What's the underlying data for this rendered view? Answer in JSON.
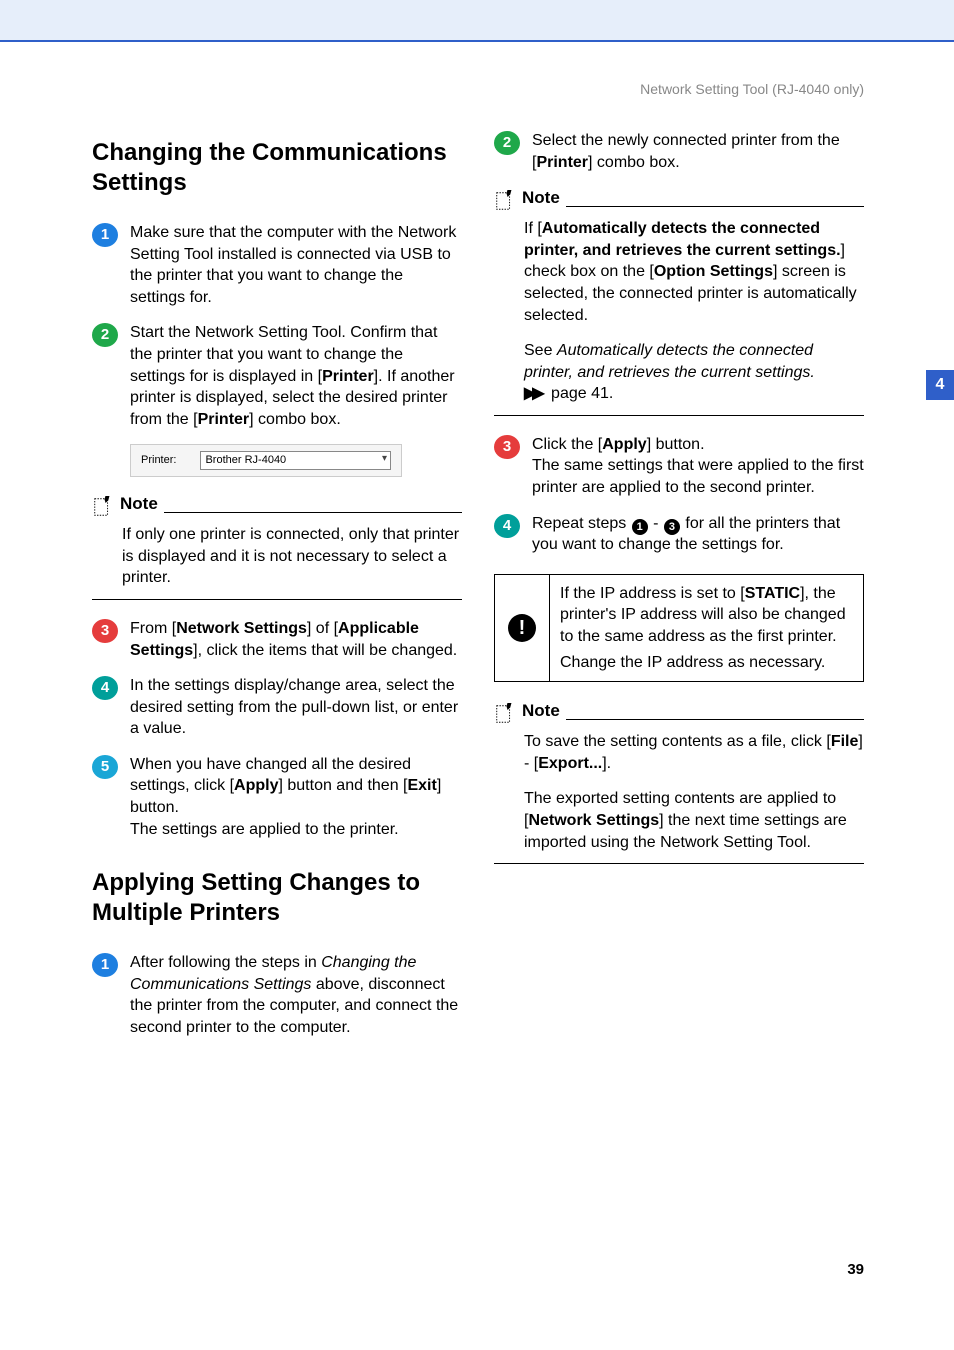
{
  "header": {
    "running_head": "Network Setting Tool (RJ-4040 only)",
    "side_tab_number": "4",
    "page_number": "39"
  },
  "sections": {
    "changing": {
      "title": "Changing the Communications Settings",
      "steps": [
        "Make sure that the computer with the Network Setting Tool installed is connected via USB to the printer that you want to change the settings for.",
        "Start the Network Setting Tool. Confirm that the printer that you want to change the settings for is displayed in [Printer]. If another printer is displayed, select the desired printer from the [Printer] combo box.",
        "From [Network Settings] of [Applicable Settings], click the items that will be changed.",
        "In the settings display/change area, select the desired setting from the pull-down list, or enter a value.",
        "When you have changed all the desired settings, click [Apply] button and then [Exit] button.\nThe settings are applied to the printer."
      ],
      "printer_field": {
        "label": "Printer:",
        "value": "Brother RJ-4040"
      },
      "note1": "If only one printer is connected, only that printer is displayed and it is not necessary to select a printer."
    },
    "applying": {
      "title": "Applying Setting Changes to Multiple Printers",
      "steps_left": [
        "After following the steps in Changing the Communications Settings above, disconnect the printer from the computer, and connect the second printer to the computer."
      ],
      "steps_right": [
        "Select the newly connected printer from the [Printer] combo box.",
        "Click the [Apply] button.\nThe same settings that were applied to the first printer are applied to the second printer.",
        "Repeat steps 1 - 3 for all the printers that you want to change the settings for."
      ],
      "note_right1a": "If [Automatically detects the connected printer, and retrieves the current settings.] check box on the [Option Settings] screen is selected, the connected printer is automatically selected.",
      "note_right1b_pre": "See ",
      "note_right1b_ital": "Automatically detects the connected printer, and retrieves the current settings.",
      "note_right1b_post": " page 41.",
      "warn1": "If the IP address is set to [STATIC], the printer's IP address will also be changed to the same address as the first printer.",
      "warn2": "Change the IP address as necessary.",
      "note_right2a": "To save the setting contents as a file, click [File] - [Export...].",
      "note_right2b": "The exported setting contents are applied to [Network Settings] the next time settings are imported using the Network Setting Tool."
    }
  },
  "labels": {
    "note": "Note"
  }
}
